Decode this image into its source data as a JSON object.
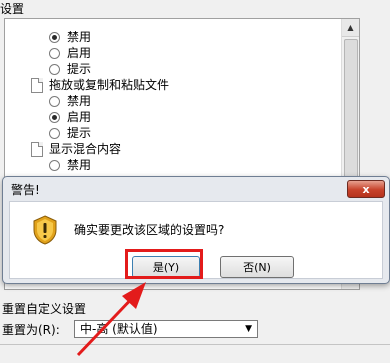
{
  "panel": {
    "heading": "设置",
    "group1": {
      "options": [
        "禁用",
        "启用",
        "提示"
      ]
    },
    "group2": {
      "title": "拖放或复制和粘贴文件",
      "options": [
        "禁用",
        "启用",
        "提示"
      ]
    },
    "group3": {
      "title": "显示混合内容",
      "options": [
        "禁用"
      ]
    }
  },
  "dialog": {
    "title": "警告!",
    "close": "x",
    "message": "确实要更改该区域的设置吗?",
    "yes": "是(Y)",
    "no": "否(N)"
  },
  "reset": {
    "title": "重置自定义设置",
    "label": "重置为(R):",
    "value": "中-高 (默认值)"
  },
  "icons": [
    "document-icon",
    "warning-shield-icon",
    "scroll-up-icon",
    "dropdown-arrow-icon",
    "red-annotation-arrow"
  ],
  "colors": {
    "annotation": "#e31b1b",
    "close_button": "#c7422a"
  }
}
